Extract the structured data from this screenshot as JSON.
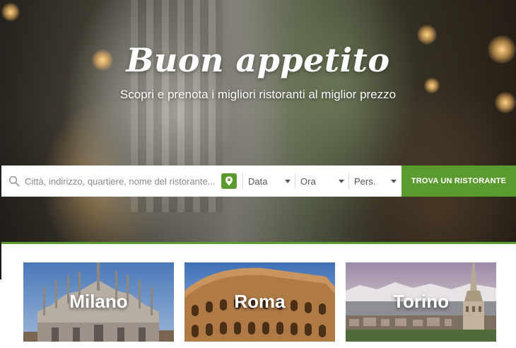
{
  "hero": {
    "title": "Buon appetito",
    "subtitle": "Scopri e prenota i migliori ristoranti al miglior prezzo"
  },
  "search": {
    "placeholder": "Città, indirizzo, quartiere, nome del ristorante...",
    "date_label": "Data",
    "time_label": "Ora",
    "people_label": "Pers.",
    "cta_label": "TROVA UN RISTORANTE"
  },
  "cities": [
    {
      "name": "Milano"
    },
    {
      "name": "Roma"
    },
    {
      "name": "Torino"
    }
  ],
  "colors": {
    "accent": "#5b9a2e",
    "cta_text": "#ffffff"
  },
  "icons": [
    "search-icon",
    "location-pin-icon",
    "chevron-down-icon"
  ]
}
